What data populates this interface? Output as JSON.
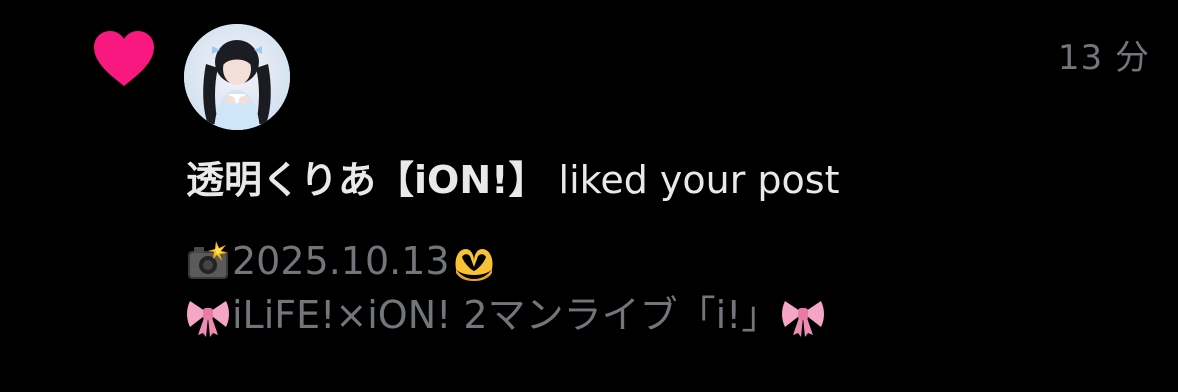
{
  "notification": {
    "type_icon": "heart-icon",
    "accent_color": "#f91880",
    "avatar": "user-avatar",
    "timestamp": "13 分",
    "user_name": "透明くりあ【iON!】",
    "action_text": " liked your post",
    "post_preview": {
      "line1_emoji": "camera-flash-emoji",
      "line1_text": "2025.10.13",
      "line1_trailing_emoji": "heart-hands-emoji",
      "line2_emoji": "ribbon-emoji",
      "line2_text": "iLiFE!×iON! 2マンライブ「i!」",
      "line2_trailing_emoji": "ribbon-emoji"
    }
  }
}
